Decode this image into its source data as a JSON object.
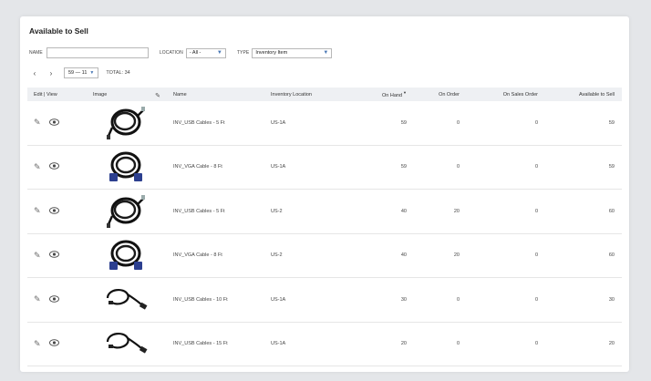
{
  "panel": {
    "title": "Available to Sell"
  },
  "filters": {
    "name_label": "NAME",
    "name_value": "",
    "location_label": "LOCATION",
    "location_value": "- All -",
    "type_label": "TYPE",
    "type_value": "Inventory Item"
  },
  "pager": {
    "prev": "‹",
    "next": "›",
    "range": "59 — 11",
    "total_label": "TOTAL:",
    "total_value": "34"
  },
  "columns": {
    "edit_view": "Edit | View",
    "image": "Image",
    "name": "Name",
    "location": "Inventory Location",
    "on_hand": "On Hand",
    "on_order": "On Order",
    "on_sales_order": "On Sales Order",
    "available": "Available to Sell"
  },
  "rows": [
    {
      "image": "usb-cable",
      "name": "INV_USB Cables - 5 Ft",
      "location": "US-1A",
      "on_hand": "59",
      "on_order": "0",
      "on_sales_order": "0",
      "available": "59"
    },
    {
      "image": "vga-cable",
      "name": "INV_VGA Cable - 8 Ft",
      "location": "US-1A",
      "on_hand": "59",
      "on_order": "0",
      "on_sales_order": "0",
      "available": "59"
    },
    {
      "image": "usb-cable",
      "name": "INV_USB Cables - 5 Ft",
      "location": "US-2",
      "on_hand": "40",
      "on_order": "20",
      "on_sales_order": "0",
      "available": "60"
    },
    {
      "image": "vga-cable",
      "name": "INV_VGA Cable - 8 Ft",
      "location": "US-2",
      "on_hand": "40",
      "on_order": "20",
      "on_sales_order": "0",
      "available": "60"
    },
    {
      "image": "usb-cable-loop",
      "name": "INV_USB Cables - 10 Ft",
      "location": "US-1A",
      "on_hand": "30",
      "on_order": "0",
      "on_sales_order": "0",
      "available": "30"
    },
    {
      "image": "usb-cable-loop",
      "name": "INV_USB Cables - 15 Ft",
      "location": "US-1A",
      "on_hand": "20",
      "on_order": "0",
      "on_sales_order": "0",
      "available": "20"
    }
  ],
  "colors": {
    "accent": "#4a78b5",
    "header_bg": "#eef0f3",
    "page_bg": "#e4e6e9",
    "vga_connector": "#2c3f8f"
  }
}
